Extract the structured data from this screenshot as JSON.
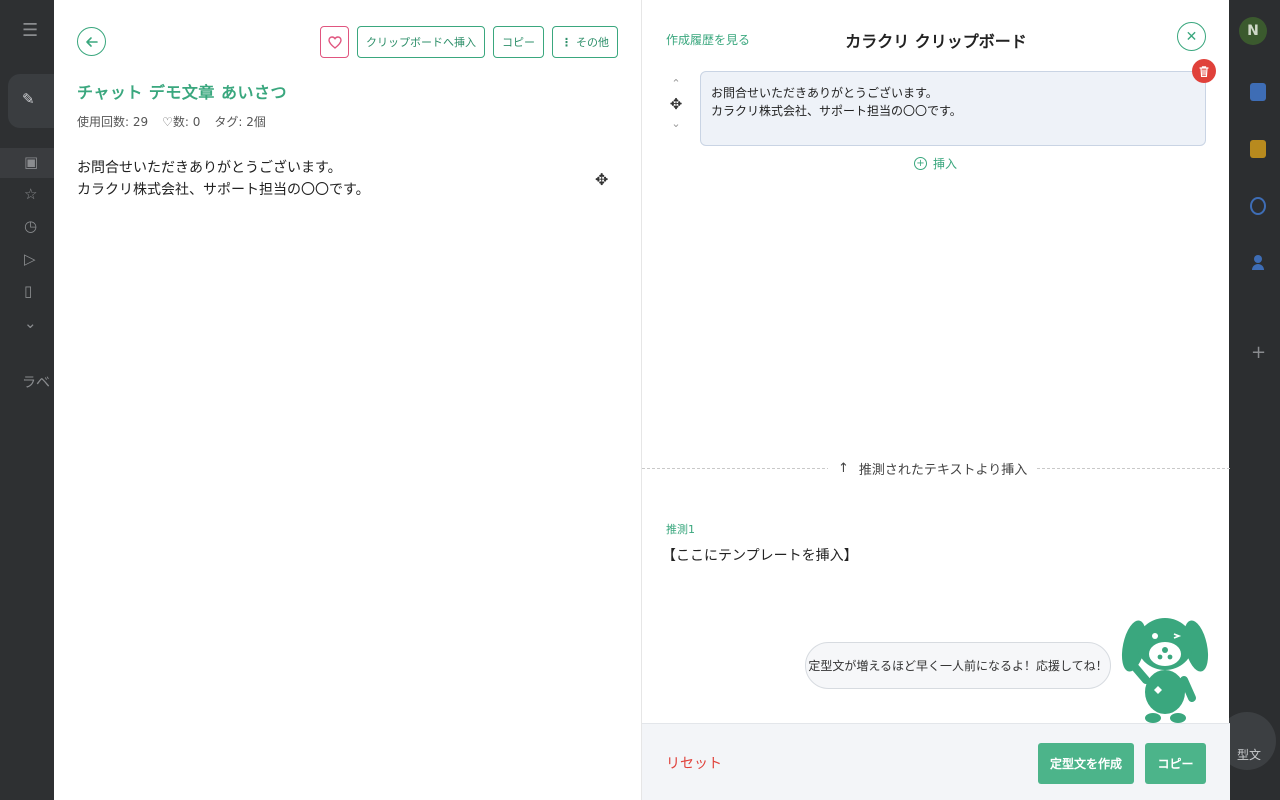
{
  "background": {
    "avatar_letter": "N",
    "label_partial": "ラベ",
    "floating_button_label": "型文"
  },
  "left_panel": {
    "toolbar": {
      "insert_label": "クリップボードへ挿入",
      "copy_label": "コピー",
      "more_label": "その他"
    },
    "title": "チャット デモ文章 あいさつ",
    "meta": {
      "usage": "使用回数: 29",
      "likes": "♡数: 0",
      "tags": "タグ: 2個"
    },
    "body_lines": [
      "お問合せいただきありがとうございます。",
      "カラクリ株式会社、サポート担当の〇〇です。"
    ]
  },
  "right_panel": {
    "history_link": "作成履歴を見る",
    "title": "カラクリ クリップボード",
    "clip_lines": [
      "お問合せいただきありがとうございます。",
      "カラクリ株式会社、サポート担当の〇〇です。"
    ],
    "insert_label": "挿入",
    "divider_label": "推測されたテキストより挿入",
    "suggestion": {
      "label": "推測1",
      "text": "【ここにテンプレートを挿入】"
    },
    "speech": "定型文が増えるほど早く一人前になるよ！応援してね！",
    "footer": {
      "reset_label": "リセット",
      "create_label": "定型文を作成",
      "copy_label": "コピー"
    }
  },
  "colors": {
    "accent": "#3aa77e",
    "button_fill": "#4cb48a",
    "danger": "#e0413a",
    "heart": "#e0557f"
  }
}
